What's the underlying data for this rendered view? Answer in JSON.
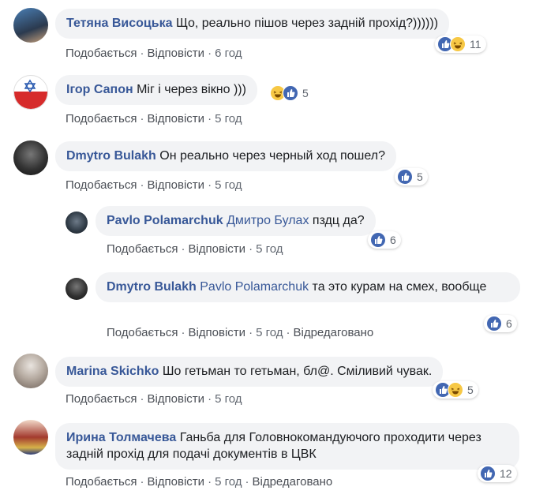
{
  "actions": {
    "like": "Подобається",
    "reply": "Відповісти",
    "edited": "Відредаговано",
    "dot": "·"
  },
  "comments": [
    {
      "author": "Тетяна Висоцька",
      "text": "Що, реально пішов через задній прохід?))))))",
      "time": "6 год",
      "reactions": [
        "like-icon",
        "haha-icon"
      ],
      "count": "11"
    },
    {
      "author": "Ігор Сапон",
      "text": "Міг і через вікно )))",
      "time": "5 год",
      "reactions": [
        "haha-icon",
        "like-icon"
      ],
      "count": "5"
    },
    {
      "author": "Dmytro Bulakh",
      "text": "Он реально через черный ход пошел?",
      "time": "5 год",
      "reactions": [
        "like-icon"
      ],
      "count": "5"
    },
    {
      "author": "Pavlo Polamarchuk",
      "mention": "Дмитро Булах",
      "text": "пздц да?",
      "time": "5 год",
      "reactions": [
        "like-icon"
      ],
      "count": "6"
    },
    {
      "author": "Dmytro Bulakh",
      "mention": "Pavlo Polamarchuk",
      "text": "та это курам на смех, вообще",
      "time": "5 год",
      "edited": true,
      "reactions": [
        "like-icon"
      ],
      "count": "6"
    },
    {
      "author": "Marina Skichko",
      "text": "Шо гетьман то гетьман, бл@. Сміливий чувак.",
      "time": "5 год",
      "reactions": [
        "like-icon",
        "haha-icon"
      ],
      "count": "5"
    },
    {
      "author": "Ирина Толмачева",
      "text": "Ганьба для Головнокомандуючого проходити через задній прохід для подачі документів в ЦВК",
      "time": "5 год",
      "edited": true,
      "reactions": [
        "like-icon"
      ],
      "count": "12"
    }
  ],
  "colors": {
    "link": "#385898",
    "bubble": "#f2f3f5",
    "like": "#4267b2",
    "haha": "#f7c845"
  }
}
